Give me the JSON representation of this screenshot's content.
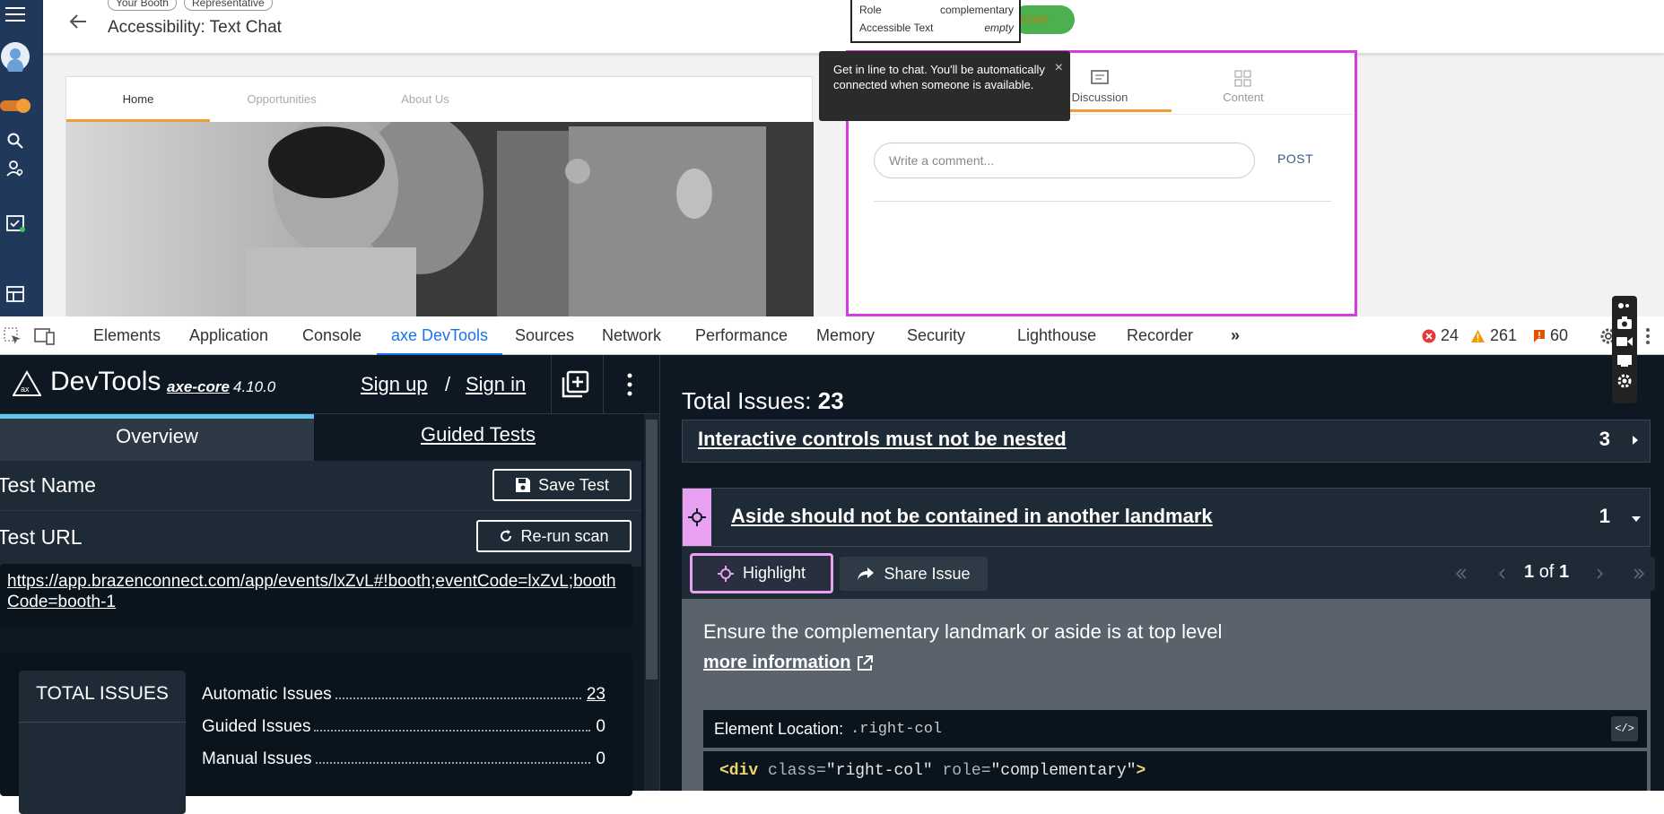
{
  "webpage": {
    "chips": [
      "Your Booth",
      "Representative"
    ],
    "title": "Accessibility: Text Chat",
    "booth_tabs": [
      "Home",
      "Opportunities",
      "About Us"
    ],
    "right_col_tabs": [
      "Discussion",
      "Content"
    ],
    "comment_placeholder": "Write a comment...",
    "post_label": "POST",
    "tooltip_text": "Get in line to chat. You'll be automatically connected when someone is available.",
    "tooltip_close": "×",
    "accessibility_popup": {
      "role_label": "Role",
      "role_value": "complementary",
      "accessible_text_label": "Accessible Text",
      "accessible_text_value": "empty"
    },
    "chat_button_label": "CHAT"
  },
  "devtools": {
    "tabs": [
      "Elements",
      "Application",
      "Console",
      "axe DevTools",
      "Sources",
      "Network",
      "Performance",
      "Memory",
      "Security",
      "Lighthouse",
      "Recorder"
    ],
    "active_tab": "axe DevTools",
    "more_tabs": "»",
    "errors": "24",
    "warnings": "261",
    "info": "60"
  },
  "axe": {
    "brand": "DevTools",
    "engine": "axe-core",
    "version": "4.10.0",
    "sign_up": "Sign up",
    "separator": "/",
    "sign_in": "Sign in",
    "tabs": {
      "overview": "Overview",
      "guided": "Guided Tests"
    },
    "test_name_label": "Test Name",
    "save_test": "Save Test",
    "test_url_label": "Test URL",
    "rerun": "Re-run scan",
    "test_url": "https://app.brazenconnect.com/app/events/lxZvL#!booth;eventCode=lxZvL;boothCode=booth-1",
    "total_issues_card": "TOTAL ISSUES",
    "summary": [
      {
        "label": "Automatic Issues",
        "value": "23"
      },
      {
        "label": "Guided Issues",
        "value": "0"
      },
      {
        "label": "Manual Issues",
        "value": "0"
      }
    ],
    "total_issues_label": "Total Issues:",
    "total_issues_value": "23",
    "issues": [
      {
        "title": "Interactive controls must not be nested",
        "count": "3"
      },
      {
        "title": "Aside should not be contained in another landmark",
        "count": "1"
      }
    ],
    "highlight": "Highlight",
    "share_issue": "Share Issue",
    "pager": {
      "current": "1",
      "of": "of",
      "total": "1"
    },
    "description": "Ensure the complementary landmark or aside is at top level",
    "more_information": "more information",
    "element_location_label": "Element Location:",
    "element_location_value": ".right-col",
    "code_tag_open": "<div",
    "code_attr1": "class=",
    "code_val1": "\"right-col\"",
    "code_attr2": "role=",
    "code_val2": "\"complementary\"",
    "code_close": ">"
  }
}
